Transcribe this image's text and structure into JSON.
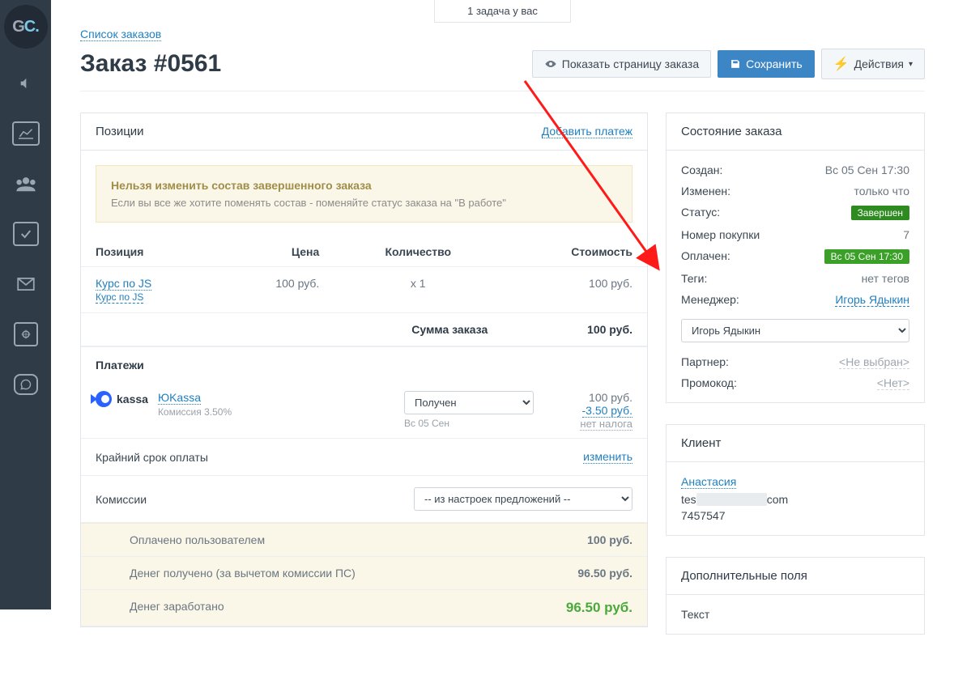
{
  "topbar": {
    "tasks": "1 задача у вас"
  },
  "crumb": {
    "back": "Список заказов"
  },
  "header": {
    "title": "Заказ #0561",
    "show_page": "Показать страницу заказа",
    "save": "Сохранить",
    "actions": "Действия"
  },
  "positions": {
    "title": "Позиции",
    "add_payment": "Добавить платеж",
    "columns": {
      "name": "Позиция",
      "price": "Цена",
      "qty": "Количество",
      "cost": "Стоимость"
    },
    "items": [
      {
        "name": "Курс по JS",
        "sub": "Курс по JS",
        "price": "100 руб.",
        "qty": "x 1",
        "cost": "100 руб."
      }
    ],
    "total_label": "Сумма заказа",
    "total_value": "100 руб."
  },
  "alert": {
    "title": "Нельзя изменить состав завершенного заказа",
    "text": "Если вы все же хотите поменять состав - поменяйте статус заказа на \"В работе\""
  },
  "payments": {
    "title": "Платежи",
    "provider_logo_text": "kassa",
    "provider_name": "ЮKassa",
    "fee_text": "Комиссия 3.50%",
    "status_options": [
      "Получен"
    ],
    "status_selected": "Получен",
    "date": "Вс 05 Сен",
    "amount": "100 руб.",
    "fee_amount": "-3.50 руб.",
    "no_tax": "нет налога"
  },
  "deadline": {
    "label": "Крайний срок оплаты",
    "change": "изменить"
  },
  "commission": {
    "label": "Комиссии",
    "options": [
      "-- из настроек предложений --"
    ],
    "selected": "-- из настроек предложений --"
  },
  "totals": {
    "paid_by_user_label": "Оплачено пользователем",
    "paid_by_user_value": "100 руб.",
    "received_label": "Денег получено (за вычетом комиссии ПС)",
    "received_value": "96.50 руб.",
    "earned_label": "Денег заработано",
    "earned_value": "96.50 руб."
  },
  "status_panel": {
    "title": "Состояние заказа",
    "created_label": "Создан:",
    "created_value": "Вс 05 Сен 17:30",
    "changed_label": "Изменен:",
    "changed_value": "только что",
    "status_label": "Статус:",
    "status_value": "Завершен",
    "purchase_label": "Номер покупки",
    "purchase_value": "7",
    "paid_label": "Оплачен:",
    "paid_value": "Вс 05 Сен 17:30",
    "tags_label": "Теги:",
    "tags_value": "нет тегов",
    "manager_label": "Менеджер:",
    "manager_value": "Игорь Ядыкин",
    "manager_options": [
      "Игорь Ядыкин"
    ],
    "manager_selected": "Игорь Ядыкин",
    "partner_label": "Партнер:",
    "partner_value": "<Не выбран>",
    "promo_label": "Промокод:",
    "promo_value": "<Нет>"
  },
  "client_panel": {
    "title": "Клиент",
    "name": "Анастасия",
    "email_prefix": "tes",
    "email_suffix": "com",
    "phone": "7457547"
  },
  "extra_panel": {
    "title": "Дополнительные поля",
    "text_label": "Текст"
  }
}
